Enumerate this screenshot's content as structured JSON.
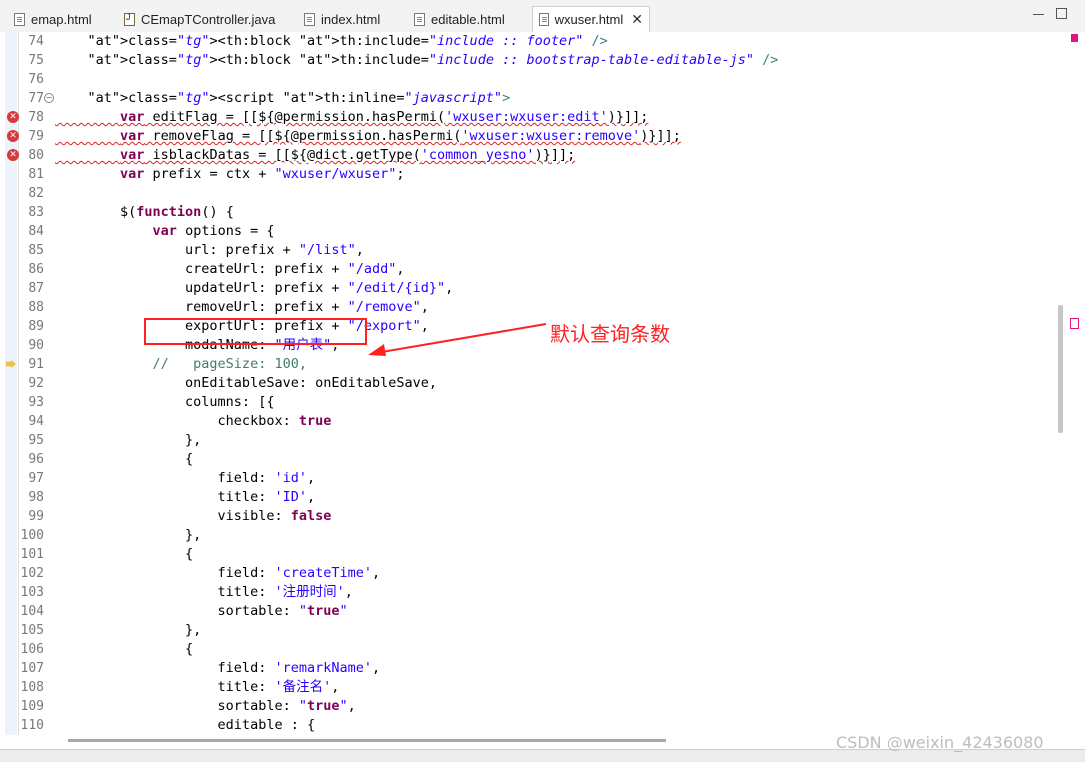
{
  "tabs": [
    {
      "label": "emap.html",
      "icon": "html-file-icon"
    },
    {
      "label": "CEmapTController.java",
      "icon": "java-file-icon"
    },
    {
      "label": "index.html",
      "icon": "html-file-icon"
    },
    {
      "label": "editable.html",
      "icon": "html-file-icon"
    },
    {
      "label": "wxuser.html",
      "icon": "html-file-icon",
      "active": true
    }
  ],
  "lines": [
    {
      "n": "74",
      "code": "    <th:block th:include=\"include :: footer\" />"
    },
    {
      "n": "75",
      "code": "    <th:block th:include=\"include :: bootstrap-table-editable-js\" />"
    },
    {
      "n": "76",
      "code": ""
    },
    {
      "n": "77",
      "code": "    <script th:inline=\"javascript\">",
      "fold": true
    },
    {
      "n": "78",
      "code": "        var editFlag = [[${@permission.hasPermi('wxuser:wxuser:edit')}]];",
      "error": true
    },
    {
      "n": "79",
      "code": "        var removeFlag = [[${@permission.hasPermi('wxuser:wxuser:remove')}]];",
      "error": true
    },
    {
      "n": "80",
      "code": "        var isblackDatas = [[${@dict.getType('common_yesno')}]];",
      "error": true
    },
    {
      "n": "81",
      "code": "        var prefix = ctx + \"wxuser/wxuser\";"
    },
    {
      "n": "82",
      "code": ""
    },
    {
      "n": "83",
      "code": "        $(function() {"
    },
    {
      "n": "84",
      "code": "            var options = {"
    },
    {
      "n": "85",
      "code": "                url: prefix + \"/list\","
    },
    {
      "n": "86",
      "code": "                createUrl: prefix + \"/add\","
    },
    {
      "n": "87",
      "code": "                updateUrl: prefix + \"/edit/{id}\","
    },
    {
      "n": "88",
      "code": "                removeUrl: prefix + \"/remove\","
    },
    {
      "n": "89",
      "code": "                exportUrl: prefix + \"/export\","
    },
    {
      "n": "90",
      "code": "                modalName: \"用户表\","
    },
    {
      "n": "91",
      "code": "            //   pageSize: 100,",
      "marker": true
    },
    {
      "n": "92",
      "code": "                onEditableSave: onEditableSave,"
    },
    {
      "n": "93",
      "code": "                columns: [{"
    },
    {
      "n": "94",
      "code": "                    checkbox: true"
    },
    {
      "n": "95",
      "code": "                },"
    },
    {
      "n": "96",
      "code": "                {"
    },
    {
      "n": "97",
      "code": "                    field: 'id',"
    },
    {
      "n": "98",
      "code": "                    title: 'ID',"
    },
    {
      "n": "99",
      "code": "                    visible: false"
    },
    {
      "n": "100",
      "code": "                },"
    },
    {
      "n": "101",
      "code": "                {"
    },
    {
      "n": "102",
      "code": "                    field: 'createTime',"
    },
    {
      "n": "103",
      "code": "                    title: '注册时间',"
    },
    {
      "n": "104",
      "code": "                    sortable: \"true\""
    },
    {
      "n": "105",
      "code": "                },"
    },
    {
      "n": "106",
      "code": "                {"
    },
    {
      "n": "107",
      "code": "                    field: 'remarkName',"
    },
    {
      "n": "108",
      "code": "                    title: '备注名',"
    },
    {
      "n": "109",
      "code": "                    sortable: \"true\","
    },
    {
      "n": "110",
      "code": "                    editable : {"
    }
  ],
  "annotation": {
    "text": "默认查询条数",
    "color": "#ff2020"
  },
  "watermark": "CSDN @weixin_42436080"
}
